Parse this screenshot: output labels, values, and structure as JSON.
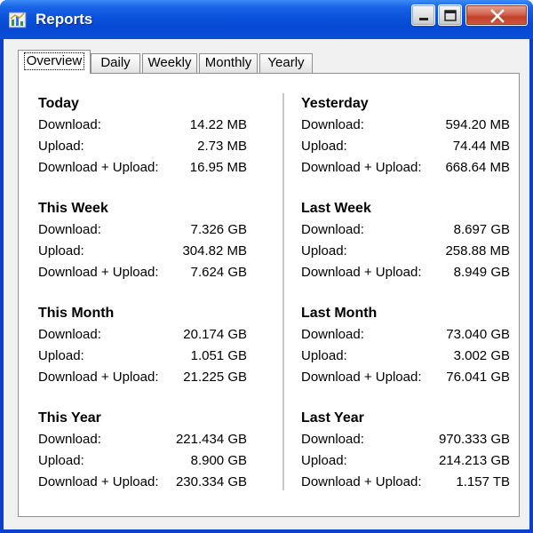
{
  "window": {
    "title": "Reports"
  },
  "tabs": [
    {
      "label": "Overview",
      "active": true
    },
    {
      "label": "Daily",
      "active": false
    },
    {
      "label": "Weekly",
      "active": false
    },
    {
      "label": "Monthly",
      "active": false
    },
    {
      "label": "Yearly",
      "active": false
    }
  ],
  "labels": {
    "download": "Download:",
    "upload": "Upload:",
    "total": "Download + Upload:"
  },
  "sections": {
    "today": {
      "title": "Today",
      "download": "14.22 MB",
      "upload": "2.73 MB",
      "total": "16.95 MB"
    },
    "yesterday": {
      "title": "Yesterday",
      "download": "594.20 MB",
      "upload": "74.44 MB",
      "total": "668.64 MB"
    },
    "this_week": {
      "title": "This Week",
      "download": "7.326 GB",
      "upload": "304.82 MB",
      "total": "7.624 GB"
    },
    "last_week": {
      "title": "Last Week",
      "download": "8.697 GB",
      "upload": "258.88 MB",
      "total": "8.949 GB"
    },
    "this_month": {
      "title": "This Month",
      "download": "20.174 GB",
      "upload": "1.051 GB",
      "total": "21.225 GB"
    },
    "last_month": {
      "title": "Last Month",
      "download": "73.040 GB",
      "upload": "3.002 GB",
      "total": "76.041 GB"
    },
    "this_year": {
      "title": "This Year",
      "download": "221.434 GB",
      "upload": "8.900 GB",
      "total": "230.334 GB"
    },
    "last_year": {
      "title": "Last Year",
      "download": "970.333 GB",
      "upload": "214.213 GB",
      "total": "1.157 TB"
    }
  },
  "icons": {
    "app": "bar-chart-icon",
    "minimize": "minimize-icon",
    "maximize": "maximize-icon",
    "close": "close-icon"
  },
  "colors": {
    "titlebar": "#0b52dc",
    "close_button": "#c2402a",
    "client_background": "#f0f0f0"
  }
}
